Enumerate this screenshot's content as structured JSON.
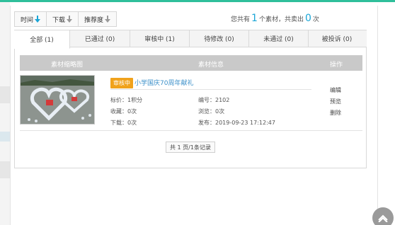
{
  "sort": {
    "items": [
      {
        "label": "时间",
        "color": "#1aa5d6"
      },
      {
        "label": "下载",
        "color": "#9a9a9a"
      },
      {
        "label": "推荐度",
        "color": "#9a9a9a"
      }
    ]
  },
  "summary": {
    "prefix": "您共有",
    "count": "1",
    "middle": "个素材，共卖出",
    "sold": "0",
    "suffix": "次"
  },
  "tabs": [
    {
      "label": "全部 (1)",
      "active": true
    },
    {
      "label": "已通过 (0)"
    },
    {
      "label": "审核中 (1)"
    },
    {
      "label": "待修改 (0)"
    },
    {
      "label": "未通过 (0)"
    },
    {
      "label": "被投诉 (0)"
    }
  ],
  "table": {
    "headers": {
      "thumb": "素材缩略图",
      "info": "素材信息",
      "ops": "操作"
    },
    "row": {
      "status": "审核中",
      "title": "小学国庆70周年献礼",
      "price": "标价：1积分",
      "id": "编号：2102",
      "favorites": "收藏：0次",
      "views": "浏览：0次",
      "downloads": "下载：0次",
      "published": "发布：2019-09-23 17:12:47",
      "actions": [
        "编辑",
        "预览",
        "删除"
      ]
    }
  },
  "pager": {
    "text": "共 1 页/1条记录"
  },
  "colors": {
    "accent": "#2fbf9b",
    "count": "#1aa5d6",
    "badge": "#f0a21c",
    "link": "#3a8fc9"
  }
}
